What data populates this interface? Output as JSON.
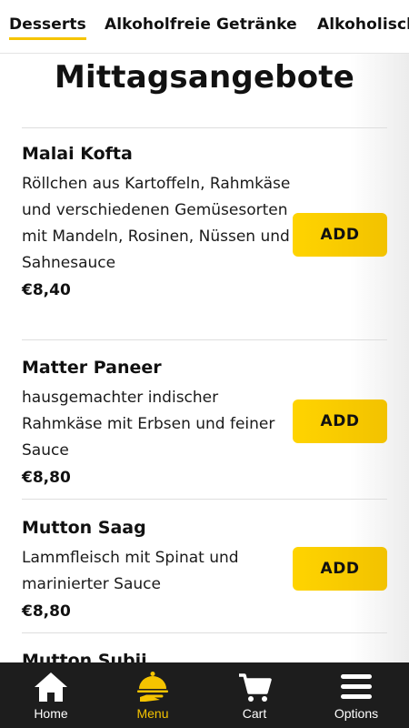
{
  "categories": {
    "tabs": [
      "Desserts",
      "Alkoholfreie Getränke",
      "Alkoholische"
    ],
    "active_index": 0
  },
  "section": {
    "title": "Mittagsangebote"
  },
  "items": [
    {
      "name": "Malai Kofta",
      "description": "Röllchen aus Kartoffeln, Rahmkäse und verschiedenen Gemüsesorten mit Mandeln, Rosinen, Nüssen und Sahnesauce",
      "price": "€8,40",
      "button": "ADD"
    },
    {
      "name": "Matter Paneer",
      "description": "hausgemachter indischer Rahmkäse mit Erbsen und feiner Sauce",
      "price": "€8,80",
      "button": "ADD"
    },
    {
      "name": "Mutton Saag",
      "description": "Lammfleisch mit Spinat und marinierter Sauce",
      "price": "€8,80",
      "button": "ADD"
    },
    {
      "name": "Mutton Subji"
    }
  ],
  "bottom_nav": {
    "items": [
      {
        "label": "Home",
        "icon": "home-icon"
      },
      {
        "label": "Menu",
        "icon": "food-tray-icon"
      },
      {
        "label": "Cart",
        "icon": "cart-icon"
      },
      {
        "label": "Options",
        "icon": "hamburger-menu-icon"
      }
    ],
    "active_index": 1
  },
  "colors": {
    "accent": "#f5c400",
    "nav_background": "#1d1d1d",
    "text": "#111111"
  }
}
